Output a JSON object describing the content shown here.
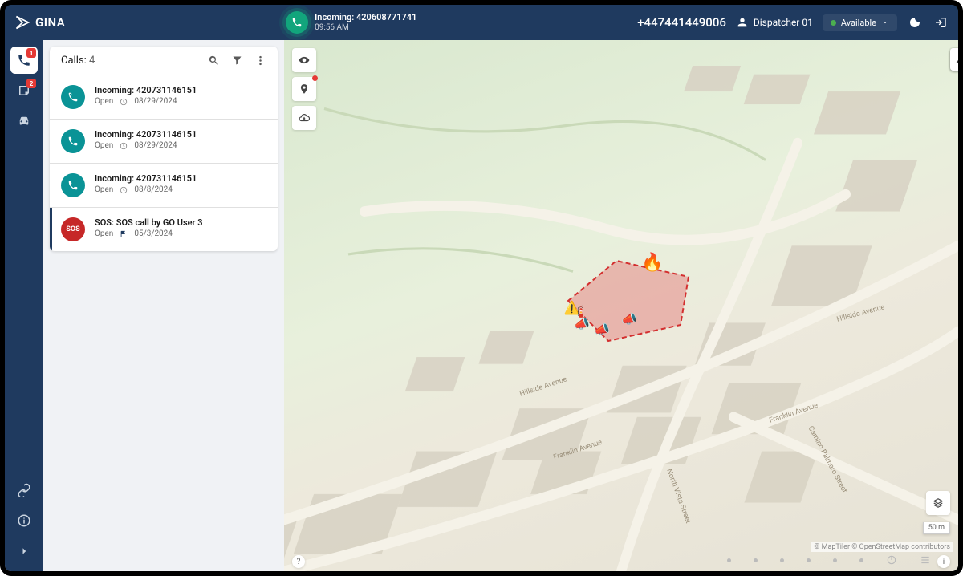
{
  "app": {
    "name": "GINA"
  },
  "header": {
    "incoming_label": "Incoming:",
    "incoming_number": "420608771741",
    "incoming_time": "09:56 AM",
    "phone": "+447441449006",
    "user": "Dispatcher 01",
    "status_label": "Available"
  },
  "rail": {
    "calls_badge": "1",
    "notes_badge": "2"
  },
  "panel": {
    "title": "Calls:",
    "count": "4"
  },
  "calls": [
    {
      "type": "incoming",
      "title": "Incoming: 420731146151",
      "status": "Open",
      "date": "08/29/2024",
      "selected": false
    },
    {
      "type": "incoming",
      "title": "Incoming: 420731146151",
      "status": "Open",
      "date": "08/29/2024",
      "selected": false
    },
    {
      "type": "incoming",
      "title": "Incoming: 420731146151",
      "status": "Open",
      "date": "08/8/2024",
      "selected": false
    },
    {
      "type": "sos",
      "title": "SOS: SOS call by GO User 3",
      "status": "Open",
      "date": "05/3/2024",
      "selected": true
    }
  ],
  "map": {
    "streets": {
      "hillside": "Hillside Avenue",
      "franklin": "Franklin Avenue",
      "franklin2": "Franklin Avenue",
      "north_vista": "North Vista Street",
      "camino": "Camino Palmero Street",
      "hillside2": "Hillside Avenue"
    },
    "scale": "50 m",
    "attribution": "© MapTiler © OpenStreetMap contributors"
  }
}
